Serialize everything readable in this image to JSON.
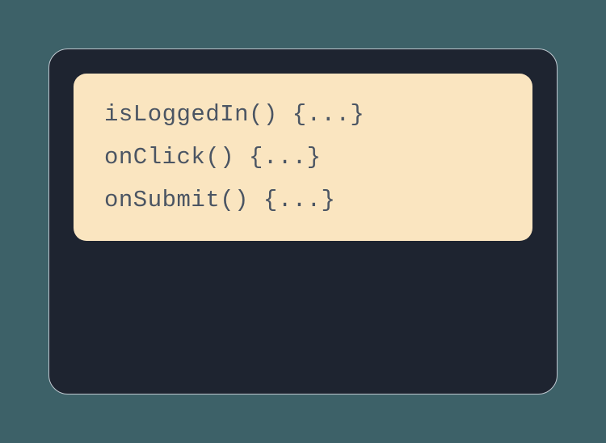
{
  "code": {
    "lines": [
      "isLoggedIn() {...}",
      "onClick() {...}",
      "onSubmit() {...}"
    ]
  }
}
